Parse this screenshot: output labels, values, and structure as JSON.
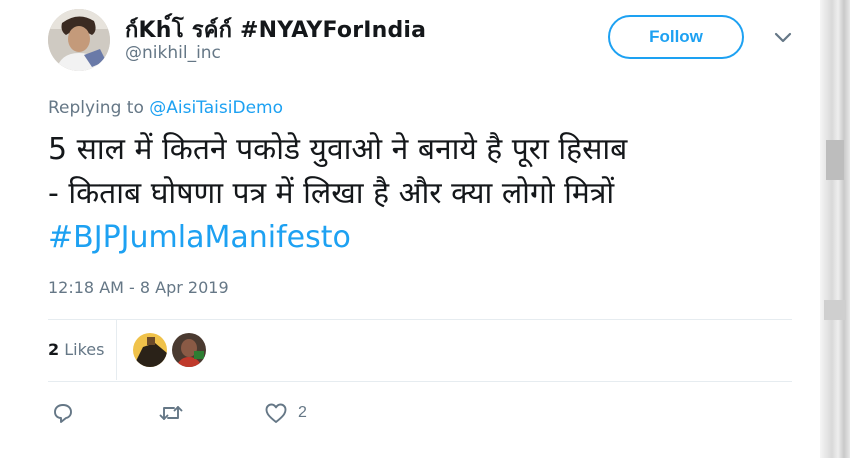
{
  "tweet": {
    "display_name": "ก์Kh์โ รค์ก์ #NYAYForIndia",
    "handle": "@nikhil_inc",
    "follow_label": "Follow",
    "replying_prefix": "Replying to ",
    "replying_to": "@AisiTaisiDemo",
    "text_line_1": "5 साल में कितने पकोडे युवाओ ने बनाये है पूरा हिसाब",
    "text_line_2": "- किताब  घोषणा पत्र में लिखा है और क्या लोगो मित्रों",
    "hashtag": "#BJPJumlaManifesto",
    "timestamp": "12:18 AM - 8 Apr 2019",
    "likes_count": "2",
    "likes_label": " Likes",
    "like_action_count": "2"
  },
  "colors": {
    "accent": "#1da1f2",
    "secondary_text": "#657786",
    "divider": "#e6ecf0"
  },
  "icons": [
    "avatar",
    "chevron-down-icon",
    "reply-icon",
    "retweet-icon",
    "heart-icon"
  ]
}
